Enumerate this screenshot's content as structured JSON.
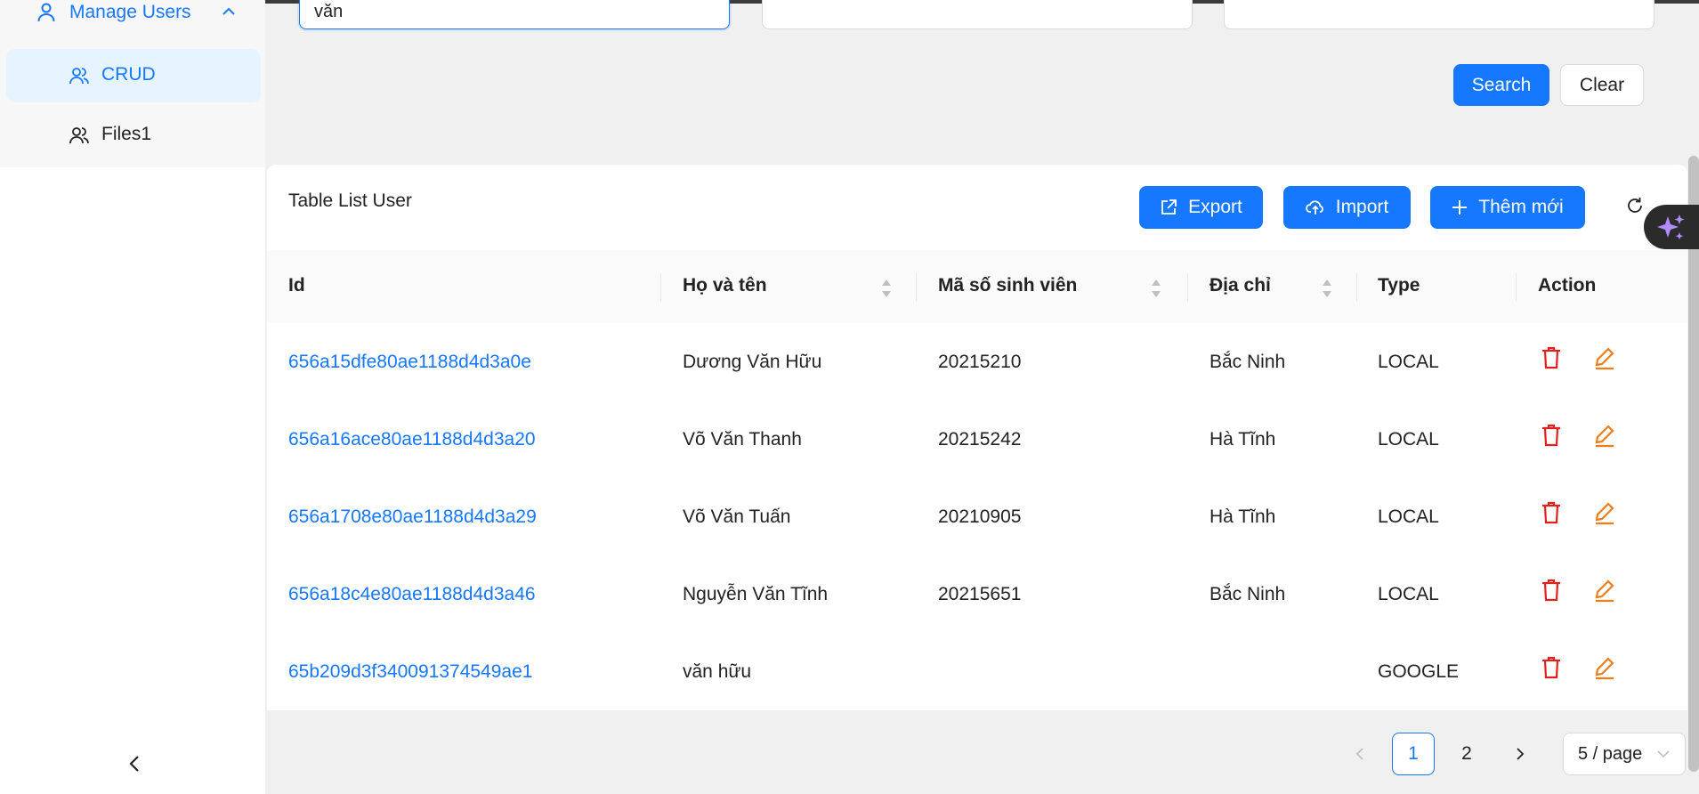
{
  "sidebar": {
    "group_label": "Manage Users",
    "items": [
      {
        "label": "CRUD",
        "active": true
      },
      {
        "label": "Files1",
        "active": false
      }
    ]
  },
  "filters": {
    "name_value": "văn",
    "field2_value": "",
    "field3_value": ""
  },
  "buttons": {
    "search": "Search",
    "clear": "Clear",
    "export": "Export",
    "import": "Import",
    "add": "Thêm mới"
  },
  "table": {
    "title": "Table List User",
    "columns": [
      "Id",
      "Họ và tên",
      "Mã số sinh viên",
      "Địa chỉ",
      "Type",
      "Action"
    ],
    "rows": [
      {
        "id": "656a15dfe80ae1188d4d3a0e",
        "name": "Dương Văn Hữu",
        "student_id": "20215210",
        "address": "Bắc Ninh",
        "type": "LOCAL"
      },
      {
        "id": "656a16ace80ae1188d4d3a20",
        "name": "Võ Văn Thanh",
        "student_id": "20215242",
        "address": "Hà Tĩnh",
        "type": "LOCAL"
      },
      {
        "id": "656a1708e80ae1188d4d3a29",
        "name": "Võ Văn Tuấn",
        "student_id": "20210905",
        "address": "Hà Tĩnh",
        "type": "LOCAL"
      },
      {
        "id": "656a18c4e80ae1188d4d3a46",
        "name": "Nguyễn Văn Tĩnh",
        "student_id": "20215651",
        "address": "Bắc Ninh",
        "type": "LOCAL"
      },
      {
        "id": "65b209d3f340091374549ae1",
        "name": "văn hữu",
        "student_id": "",
        "address": "",
        "type": "GOOGLE"
      }
    ]
  },
  "pagination": {
    "pages": [
      "1",
      "2"
    ],
    "current": "1",
    "page_size": "5 / page"
  },
  "colors": {
    "primary": "#1677ff",
    "delete": "#e0201c",
    "edit": "#f07c1a"
  }
}
